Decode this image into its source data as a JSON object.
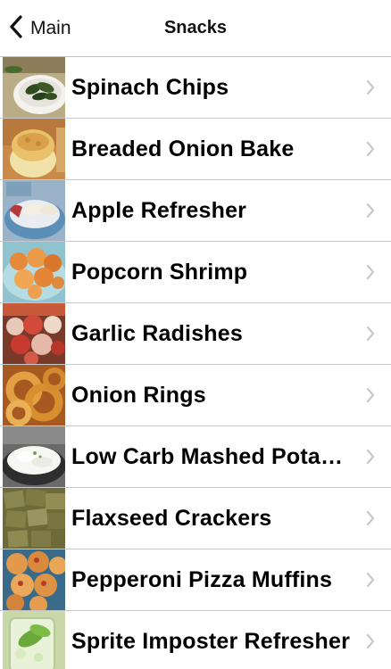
{
  "nav": {
    "back_label": "Main",
    "title": "Snacks"
  },
  "items": [
    {
      "label": "Spinach Chips",
      "thumb": "spinach-chips-thumbnail"
    },
    {
      "label": "Breaded Onion Bake",
      "thumb": "breaded-onion-bake-thumbnail"
    },
    {
      "label": "Apple Refresher",
      "thumb": "apple-refresher-thumbnail"
    },
    {
      "label": "Popcorn Shrimp",
      "thumb": "popcorn-shrimp-thumbnail"
    },
    {
      "label": "Garlic Radishes",
      "thumb": "garlic-radishes-thumbnail"
    },
    {
      "label": "Onion Rings",
      "thumb": "onion-rings-thumbnail"
    },
    {
      "label": "Low Carb Mashed Pota…",
      "thumb": "mashed-potatoes-thumbnail"
    },
    {
      "label": "Flaxseed Crackers",
      "thumb": "flaxseed-crackers-thumbnail"
    },
    {
      "label": "Pepperoni Pizza Muffins",
      "thumb": "pizza-muffins-thumbnail"
    },
    {
      "label": "Sprite Imposter Refresher",
      "thumb": "sprite-refresher-thumbnail"
    }
  ],
  "icons": {
    "back": "chevron-left-icon",
    "disclosure": "chevron-right-icon"
  },
  "colors": {
    "text": "#000000",
    "chevron": "#c7c7cc",
    "separator": "#c8c7cc"
  }
}
